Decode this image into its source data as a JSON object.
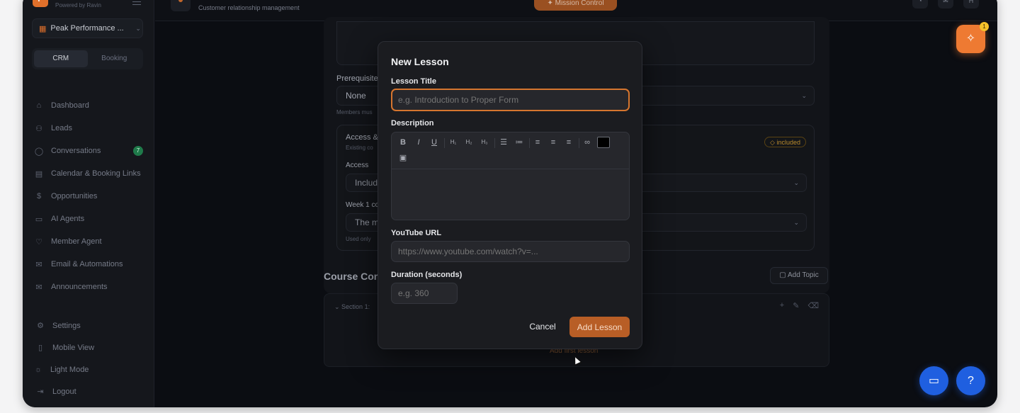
{
  "brand": {
    "logo_letter": "P",
    "subtitle": "Powered by Ravin"
  },
  "workspace": {
    "name": "Peak Performance ..."
  },
  "mode_tabs": [
    {
      "label": "CRM"
    },
    {
      "label": "Booking"
    }
  ],
  "nav": [
    {
      "label": "Dashboard",
      "icon": "home-icon"
    },
    {
      "label": "Leads",
      "icon": "users-icon"
    },
    {
      "label": "Conversations",
      "icon": "chat-icon",
      "badge": "7"
    },
    {
      "label": "Calendar & Booking Links",
      "icon": "calendar-icon"
    },
    {
      "label": "Opportunities",
      "icon": "dollar-icon"
    },
    {
      "label": "AI Agents",
      "icon": "monitor-icon"
    },
    {
      "label": "Member Agent",
      "icon": "heart-icon"
    },
    {
      "label": "Email & Automations",
      "icon": "mail-icon"
    },
    {
      "label": "Announcements",
      "icon": "mail-icon"
    }
  ],
  "bottom_nav": [
    {
      "label": "Settings",
      "icon": "gear-icon"
    },
    {
      "label": "Mobile View",
      "icon": "phone-icon"
    },
    {
      "label": "Light Mode",
      "icon": "sun-icon"
    },
    {
      "label": "Logout",
      "icon": "logout-icon"
    }
  ],
  "topbar": {
    "subtitle": "Customer relationship management",
    "mission_button": "Mission Control",
    "avatar": "H"
  },
  "background": {
    "prereq_label": "Prerequisite",
    "prereq_value": "None",
    "prereq_help": "Members mus",
    "access_title": "Access &",
    "access_sub": "Existing co",
    "included_badge": "included",
    "access_label": "Access",
    "access_value": "Include",
    "week_label": "Week 1 co",
    "week_value": "The m",
    "used_only": "Used only",
    "course_content_title": "Course Cont",
    "add_topic": "Add Topic",
    "section_label": "Section 1:",
    "add_first_lesson": "Add first lesson"
  },
  "modal": {
    "title": "New Lesson",
    "lesson_title_label": "Lesson Title",
    "lesson_title_placeholder": "e.g. Introduction to Proper Form",
    "description_label": "Description",
    "youtube_label": "YouTube URL",
    "youtube_placeholder": "https://www.youtube.com/watch?v=...",
    "duration_label": "Duration (seconds)",
    "duration_placeholder": "e.g. 360",
    "cancel_label": "Cancel",
    "add_label": "Add Lesson",
    "toolbar": {
      "bold": "B",
      "italic": "I",
      "underline": "U",
      "h1": "H₁",
      "h2": "H₂",
      "h3": "H₃"
    }
  },
  "floating": {
    "spark_badge": "1"
  },
  "colors": {
    "accent": "#e0702b",
    "primary_blue": "#1f5fe0",
    "modal_bg": "#1b1c20"
  }
}
